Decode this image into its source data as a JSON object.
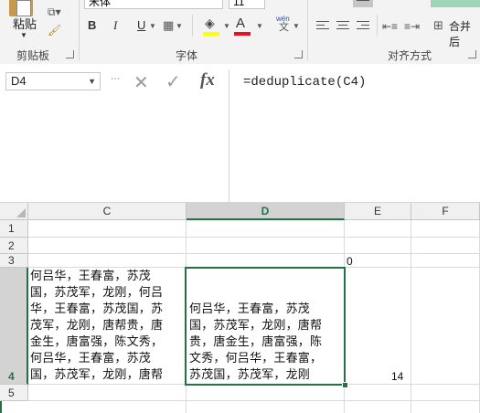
{
  "ribbon": {
    "paste_label": "粘贴",
    "font_name": "宋体",
    "font_size": "11",
    "bold": "B",
    "italic": "I",
    "underline": "U",
    "font_color_glyph": "A",
    "phonetic_glyph": "wén",
    "phonetic_sub": "文",
    "merge_label": "合并后",
    "groups": {
      "clipboard": "剪贴板",
      "font": "字体",
      "alignment": "对齐方式"
    },
    "colors": {
      "highlight": "#ffff00",
      "font_color": "#e81123",
      "accent": "#217346"
    }
  },
  "formula_bar": {
    "name_box": "D4",
    "formula": "=deduplicate(C4)",
    "icons": [
      "cancel-icon",
      "enter-icon",
      "insert-function-icon"
    ]
  },
  "sheet": {
    "columns": [
      "C",
      "D",
      "E",
      "F"
    ],
    "selected_column": "D",
    "rows": [
      "1",
      "2",
      "3",
      "4",
      "5"
    ],
    "selected_row": "4",
    "cells": {
      "E3": "0",
      "E4": "14",
      "C4_lines": [
        "何吕华，王春富，苏茂",
        "国，苏茂军，龙刚，何吕",
        "华，王春富，苏茂国，苏",
        "茂军，龙刚，唐帮贵，唐",
        "金生，唐富强，陈文秀，",
        "何吕华，王春富，苏茂",
        "国，苏茂军，龙刚，唐帮"
      ],
      "D4_lines": [
        "何吕华，王春富，苏茂",
        "国，苏茂军，龙刚，唐帮",
        "贵，唐金生，唐富强，陈",
        "文秀，何吕华，王春富，",
        "苏茂国，苏茂军，龙刚"
      ]
    }
  }
}
